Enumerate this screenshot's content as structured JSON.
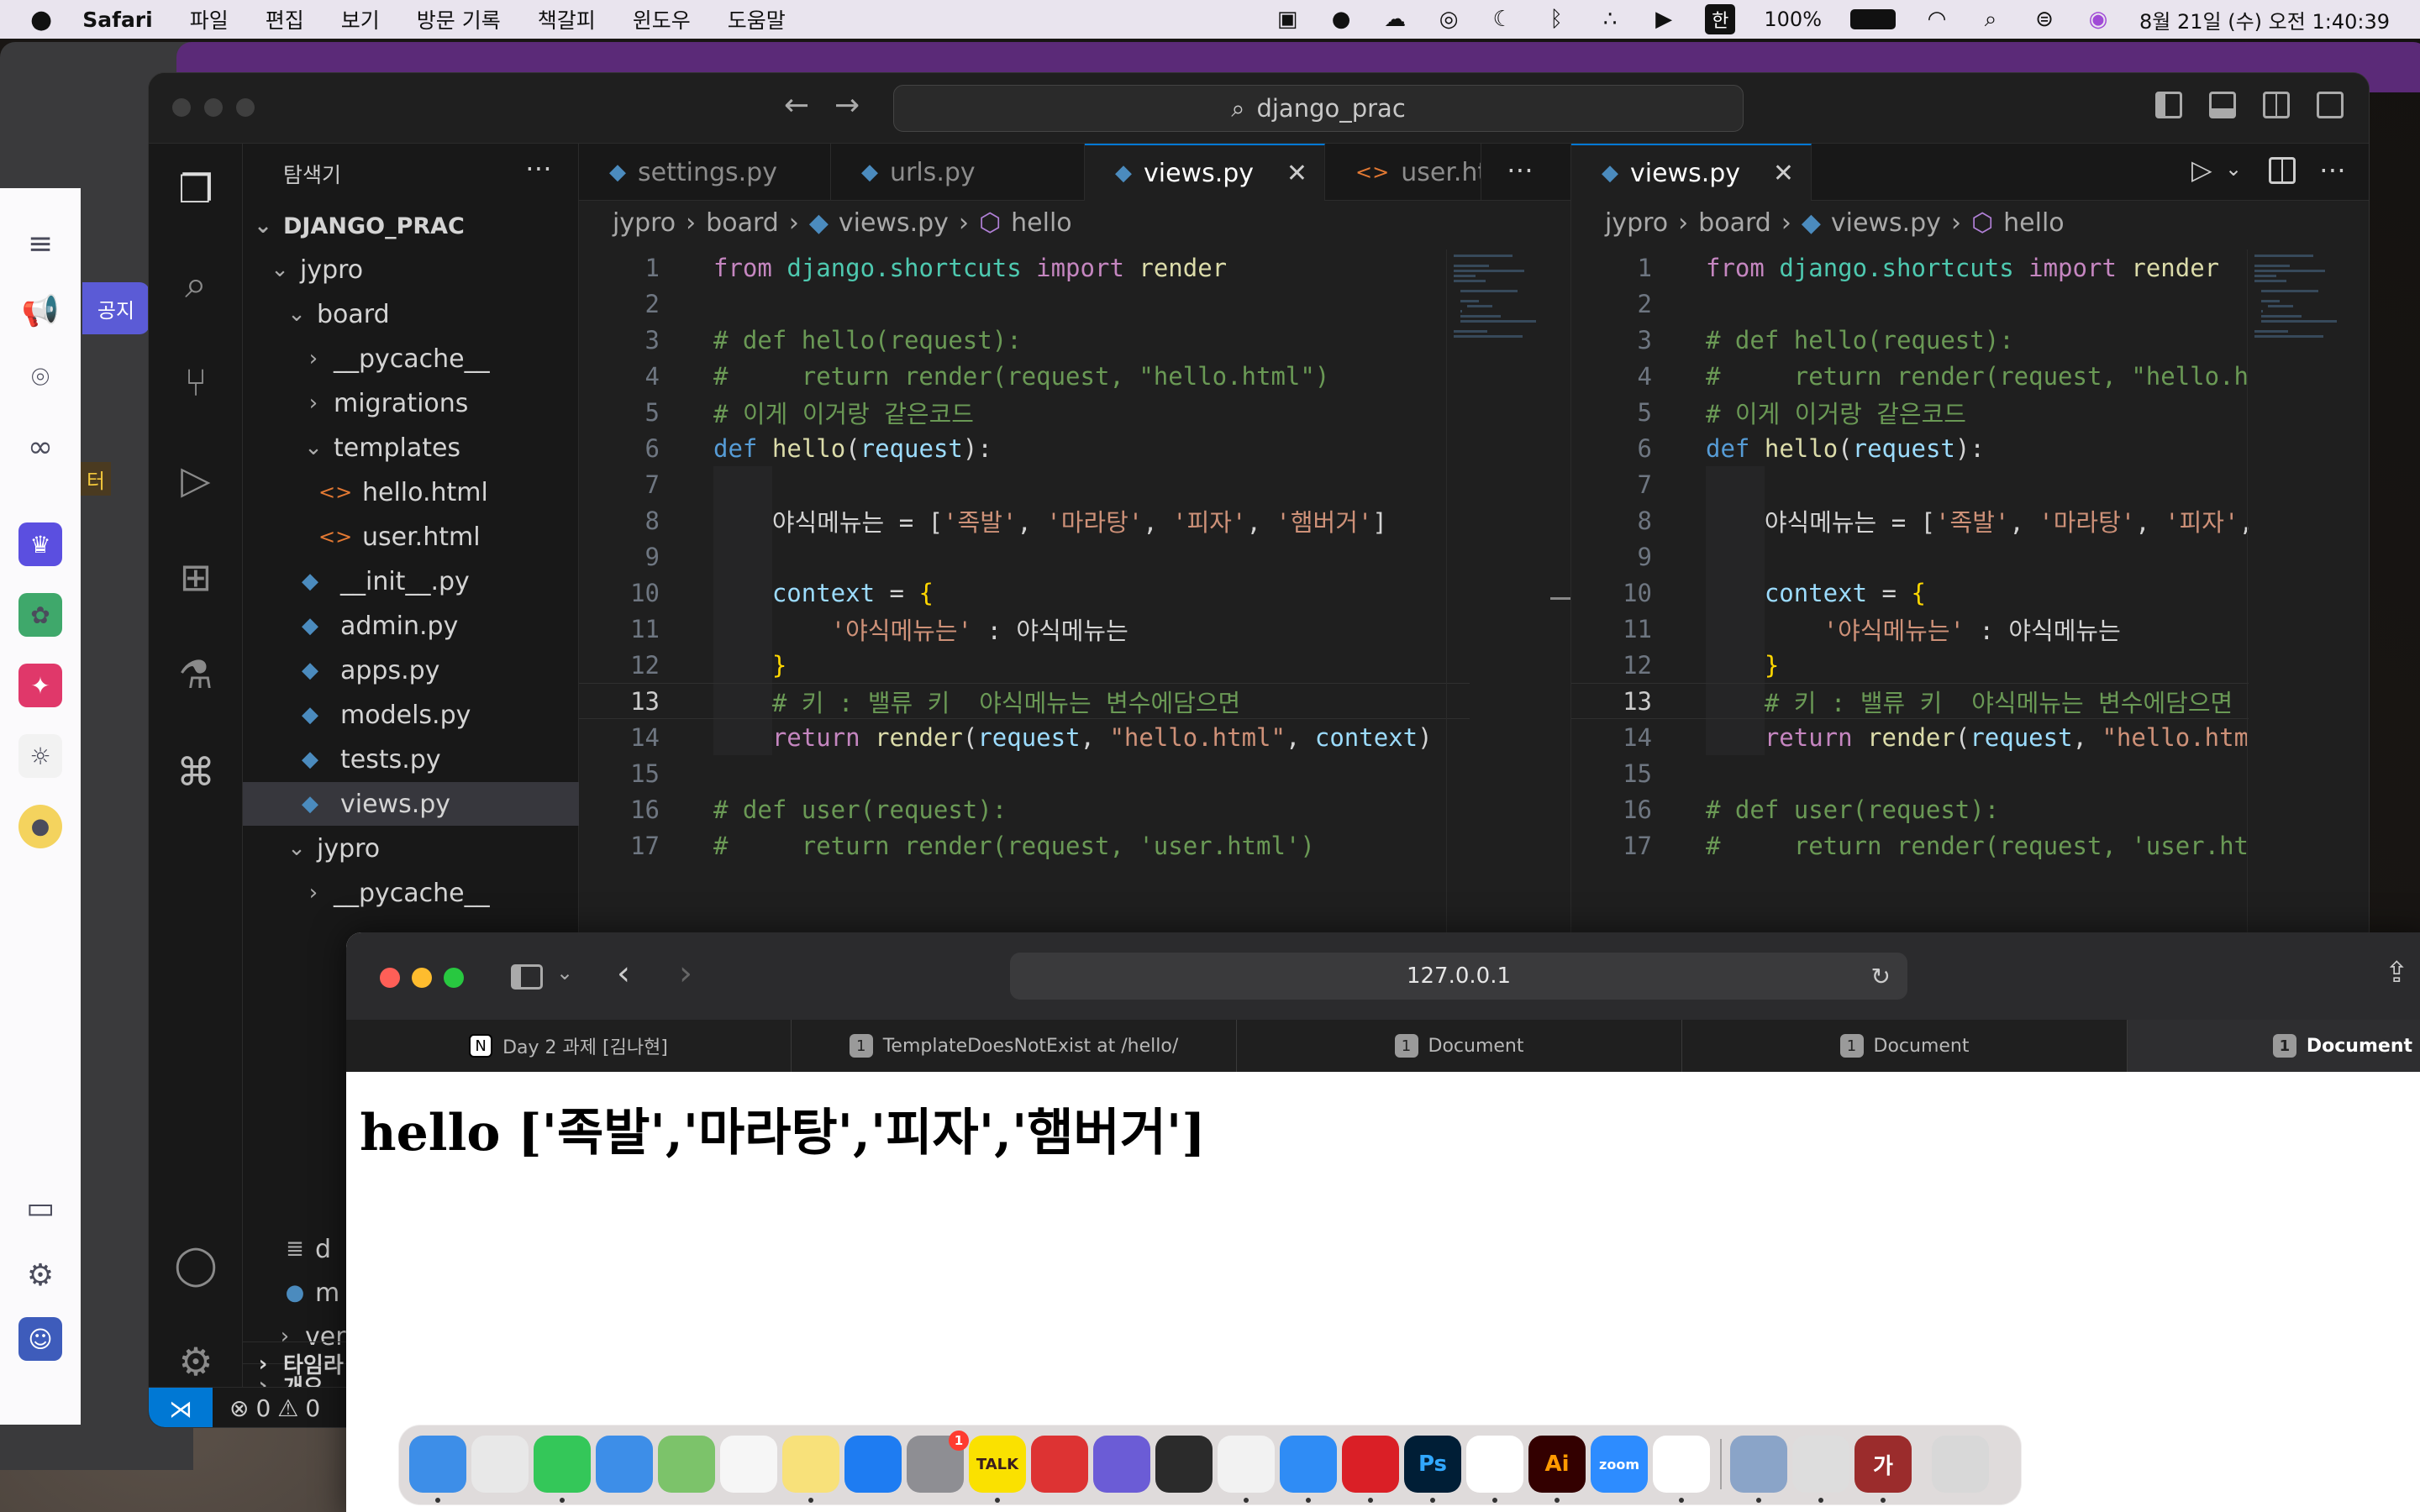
{
  "menubar": {
    "app_name": "Safari",
    "menus": [
      "파일",
      "편집",
      "보기",
      "방문 기록",
      "책갈피",
      "윈도우",
      "도움말"
    ],
    "input_source": "한",
    "battery": "100%",
    "datetime": "8월 21일 (수) 오전 1:40:39"
  },
  "left_app": {
    "notice_label": "공지",
    "side_label": "터"
  },
  "vscode": {
    "search_text": "django_prac",
    "explorer": {
      "title": "탐색기",
      "root": "DJANGO_PRAC",
      "items": [
        {
          "label": "jypro",
          "depth": 1,
          "kind": "folder-open"
        },
        {
          "label": "board",
          "depth": 2,
          "kind": "folder-open"
        },
        {
          "label": "__pycache__",
          "depth": 3,
          "kind": "folder"
        },
        {
          "label": "migrations",
          "depth": 3,
          "kind": "folder"
        },
        {
          "label": "templates",
          "depth": 3,
          "kind": "folder-open"
        },
        {
          "label": "hello.html",
          "depth": 4,
          "kind": "html"
        },
        {
          "label": "user.html",
          "depth": 4,
          "kind": "html"
        },
        {
          "label": "__init__.py",
          "depth": 3,
          "kind": "py"
        },
        {
          "label": "admin.py",
          "depth": 3,
          "kind": "py"
        },
        {
          "label": "apps.py",
          "depth": 3,
          "kind": "py"
        },
        {
          "label": "models.py",
          "depth": 3,
          "kind": "py"
        },
        {
          "label": "tests.py",
          "depth": 3,
          "kind": "py"
        },
        {
          "label": "views.py",
          "depth": 3,
          "kind": "py",
          "selected": true
        },
        {
          "label": "jypro",
          "depth": 2,
          "kind": "folder-open"
        },
        {
          "label": "__pycache__",
          "depth": 3,
          "kind": "folder"
        }
      ],
      "partial_items": [
        "d",
        "m",
        "ver"
      ],
      "outline": "개요",
      "timeline": "타임라"
    },
    "left_tabs": [
      "settings.py",
      "urls.py",
      "views.py",
      "user.htr"
    ],
    "right_tab": "views.py",
    "breadcrumbs": [
      "jypro",
      "board",
      "views.py",
      "hello"
    ],
    "status": {
      "errors": "0",
      "warnings": "0"
    },
    "code_lines": [
      "from django.shortcuts import render",
      "",
      "# def hello(request):",
      "#     return render(request, \"hello.html\")",
      "# 이게 이거랑 같은코드",
      "def hello(request):",
      "",
      "    야식메뉴는 = ['족발', '마라탕', '피자', '햄버거']",
      "",
      "    context = {",
      "        '야식메뉴는' : 야식메뉴는",
      "    }",
      "    # 키 : 밸류 키  야식메뉴는 변수에담으면",
      "    return render(request, \"hello.html\", context)",
      "",
      "# def user(request):",
      "#     return render(request, 'user.html')"
    ],
    "right_code_lines": [
      "from django.shortcuts import render",
      "",
      "# def hello(request):",
      "#     return render(request, \"hello.ht",
      "# 이게 이거랑 같은코드",
      "def hello(request):",
      "",
      "    야식메뉴는 = ['족발', '마라탕', '피자', '",
      "",
      "    context = {",
      "        '야식메뉴는' : 야식메뉴는",
      "    }",
      "    # 키 : 밸류 키  야식메뉴는 변수에담으면",
      "    return render(request, \"hello.html",
      "",
      "# def user(request):",
      "#     return render(request, 'user.htm"
    ],
    "current_line": 13
  },
  "safari": {
    "url": "127.0.0.1",
    "tabs": [
      {
        "label": "Day 2 과제 [김나현]",
        "badge": "N"
      },
      {
        "label": "TemplateDoesNotExist at /hello/",
        "badge": "1"
      },
      {
        "label": "Document",
        "badge": "1"
      },
      {
        "label": "Document",
        "badge": "1"
      },
      {
        "label": "Document",
        "badge": "1",
        "active": true
      }
    ],
    "page_heading": "hello ['족발','마라탕','피자','햄버거']"
  },
  "dock": {
    "apps": [
      "finder",
      "launchpad",
      "messages",
      "mail",
      "maps",
      "photos",
      "notes",
      "app-store",
      "system-settings",
      "kakaotalk",
      "screenshot",
      "whale",
      "garageband",
      "chrome",
      "safari",
      "creative-cloud",
      "photoshop",
      "slack",
      "illustrator",
      "zoom",
      "vscode",
      "preview",
      "keychain",
      "dictionary",
      "trash"
    ],
    "labels": {
      "photoshop": "Ps",
      "illustrator": "Ai",
      "zoom": "zoom",
      "kakaotalk": "TALK",
      "dictionary": "가"
    },
    "badge_system_settings": "1"
  },
  "colors": {
    "accent": "#0078d4",
    "keyword": "#569cd6",
    "string": "#ce9178",
    "comment": "#6a9955",
    "function": "#dcdcaa",
    "variable": "#9cdcfe"
  }
}
